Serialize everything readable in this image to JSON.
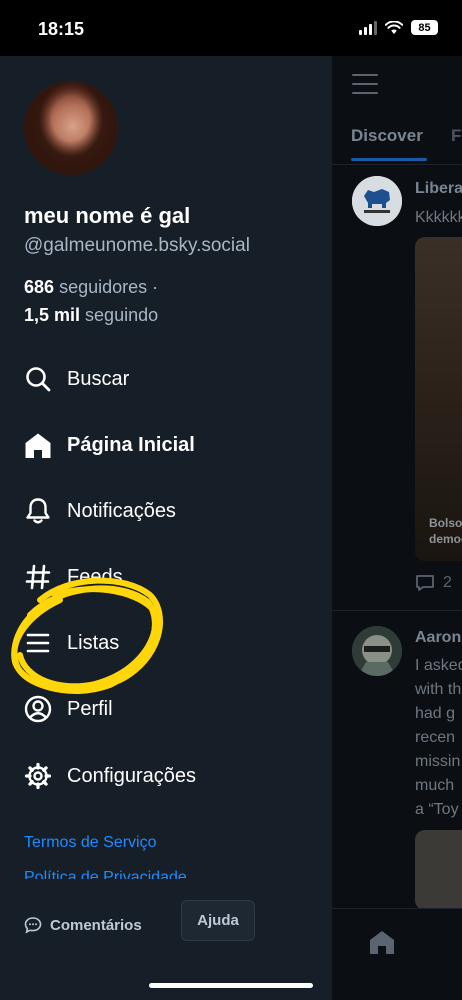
{
  "status_bar": {
    "time": "18:15",
    "battery": "85"
  },
  "profile": {
    "name": "meu nome é gal",
    "handle": "@galmeunome.bsky.social",
    "followers_count": "686",
    "followers_label": "seguidores ·",
    "following_count": "1,5 mil",
    "following_label": "seguindo"
  },
  "menu": [
    {
      "label": "Buscar",
      "icon": "search-icon"
    },
    {
      "label": "Página Inicial",
      "icon": "home-icon",
      "active": true
    },
    {
      "label": "Notificações",
      "icon": "bell-icon"
    },
    {
      "label": "Feeds",
      "icon": "hash-icon"
    },
    {
      "label": "Listas",
      "icon": "list-icon"
    },
    {
      "label": "Perfil",
      "icon": "user-circle-icon"
    },
    {
      "label": "Configurações",
      "icon": "gear-icon"
    }
  ],
  "footer": {
    "terms": "Termos de Serviço",
    "privacy": "Política de Privacidade",
    "feedback": "Comentários",
    "help": "Ajuda"
  },
  "background_app": {
    "tabs": [
      "Discover",
      "Following"
    ],
    "posts": [
      {
        "author": "Liberal planet",
        "text": [
          "Kkkkkk"
        ],
        "image_caption": [
          "Bolsonaro",
          "democracia"
        ],
        "reply_count": "2"
      },
      {
        "author": "Aaron",
        "text": [
          "I asked",
          "with th",
          "had g",
          "recen",
          "missin",
          "much",
          "a “Toy"
        ]
      }
    ]
  },
  "colors": {
    "drawer_bg": "#161e27",
    "accent": "#208bfe",
    "annotation": "#ffd60a"
  }
}
